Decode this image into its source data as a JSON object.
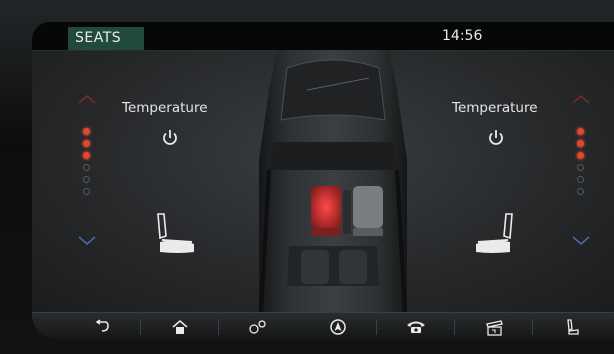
{
  "header": {
    "tab_label": "SEATS",
    "time": "14:56"
  },
  "driver_side": {
    "temperature_label": "Temperature",
    "heat_level": 3,
    "heat_levels_total": 6
  },
  "passenger_side": {
    "temperature_label": "Temperature",
    "heat_level": 3,
    "heat_levels_total": 6
  },
  "nav_items": [
    {
      "name": "back",
      "icon": "back-arrow-icon"
    },
    {
      "name": "home",
      "icon": "home-icon"
    },
    {
      "name": "connections",
      "icon": "link-icon"
    },
    {
      "name": "navigation",
      "icon": "navigation-icon"
    },
    {
      "name": "phone",
      "icon": "phone-icon"
    },
    {
      "name": "media",
      "icon": "media-icon"
    },
    {
      "name": "seats",
      "icon": "seat-icon"
    }
  ],
  "colors": {
    "accent_tab": "#214a3d",
    "heat_on": "#e4452f",
    "arrow_blue": "#4a6aa8",
    "arrow_red": "#7a2a2a"
  }
}
